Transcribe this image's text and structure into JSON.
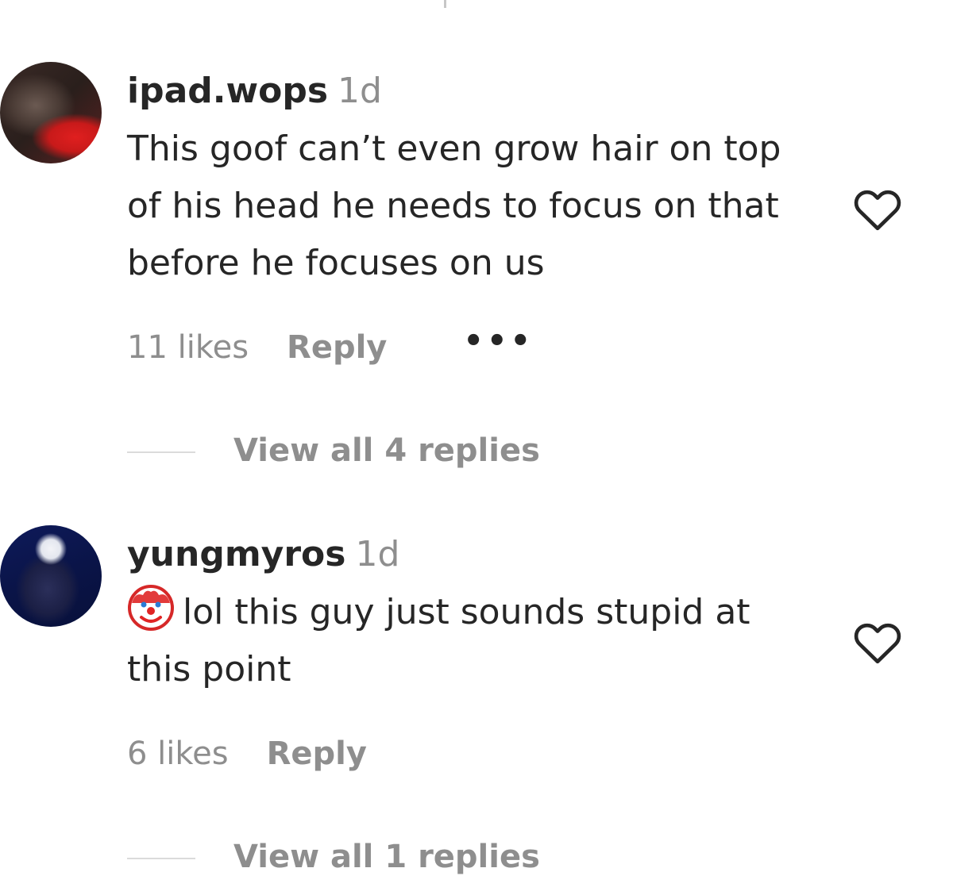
{
  "comments": [
    {
      "username": "ipad.wops",
      "time": "1d",
      "text": "This goof can’t even grow hair on top of his head he needs to focus on that before he focuses on us",
      "likes": "11 likes",
      "reply_label": "Reply",
      "more_label": "•••",
      "view_replies": "View all 4 replies",
      "avatar_icon": "profile-photo-dark-red",
      "like_icon": "heart-outline-icon"
    },
    {
      "username": "yungmyros",
      "time": "1d",
      "emoji_icon": "clown-face-icon",
      "text": "lol this guy just sounds stupid at this point",
      "likes": "6 likes",
      "reply_label": "Reply",
      "view_replies": "View all 1 replies",
      "avatar_icon": "profile-photo-dark-blue",
      "like_icon": "heart-outline-icon"
    }
  ],
  "colors": {
    "primary_text": "#262626",
    "secondary_text": "#8e8e8e",
    "divider": "#dbdbdb"
  }
}
